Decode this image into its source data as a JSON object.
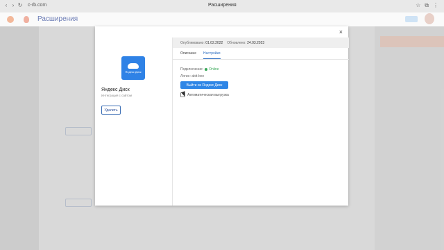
{
  "browser": {
    "url": "c-rb.com",
    "tab_title": "Расширения"
  },
  "header": {
    "title": "Расширения"
  },
  "modal": {
    "extension_title": "Яндекс Диск",
    "extension_subtitle": "Интеграция с сайтом",
    "icon_brand_text": "Яндекс Диск",
    "delete_label": "Удалить",
    "published_label": "Опубликовано:",
    "published_date": "01.02.2022",
    "updated_label": "Обновлено:",
    "updated_date": "24.03.2023",
    "tabs": [
      {
        "label": "Описание"
      },
      {
        "label": "Настройки"
      }
    ],
    "status_label": "Подключение:",
    "status_value": "Online",
    "login_label": "Логин: abit-box",
    "exit_label": "Выйти из Яндекс Диск",
    "auto_upload_label": "Автоматическая выгрузка",
    "close_icon": "close-icon"
  },
  "colors": {
    "accent": "#2f86e6",
    "online": "#38a757",
    "overlay": "#1f1f1f"
  }
}
